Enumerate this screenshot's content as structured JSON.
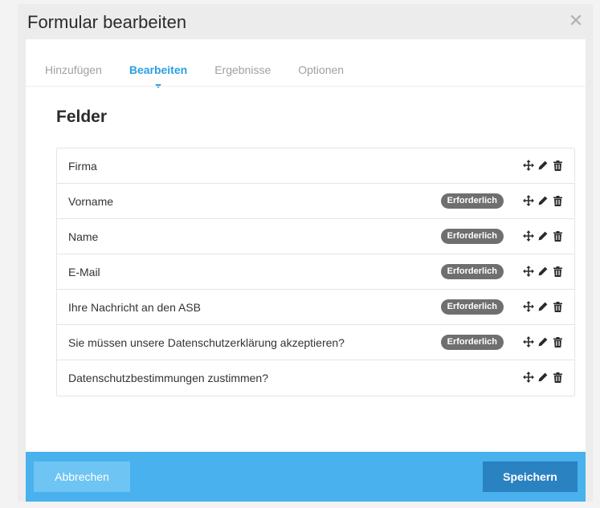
{
  "modal": {
    "title": "Formular bearbeiten",
    "close_icon": "close-icon"
  },
  "tabs": [
    {
      "label": "Hinzufügen",
      "active": false
    },
    {
      "label": "Bearbeiten",
      "active": true
    },
    {
      "label": "Ergebnisse",
      "active": false
    },
    {
      "label": "Optionen",
      "active": false
    }
  ],
  "section": {
    "title": "Felder"
  },
  "badge_label": "Erforderlich",
  "fields": [
    {
      "label": "Firma",
      "required": false
    },
    {
      "label": "Vorname",
      "required": true
    },
    {
      "label": "Name",
      "required": true
    },
    {
      "label": "E-Mail",
      "required": true
    },
    {
      "label": "Ihre Nachricht an den ASB",
      "required": true
    },
    {
      "label": "Sie müssen unsere Datenschutzerklärung akzeptieren?",
      "required": true
    },
    {
      "label": "Datenschutzbestimmungen zustimmen?",
      "required": false
    }
  ],
  "row_icons": [
    "move-icon",
    "edit-icon",
    "delete-icon"
  ],
  "footer": {
    "cancel_label": "Abbrechen",
    "save_label": "Speichern"
  },
  "colors": {
    "accent": "#2a9fe0",
    "footer": "#48b1ee",
    "save_button": "#2a82c0",
    "badge": "#6f6f6f"
  }
}
